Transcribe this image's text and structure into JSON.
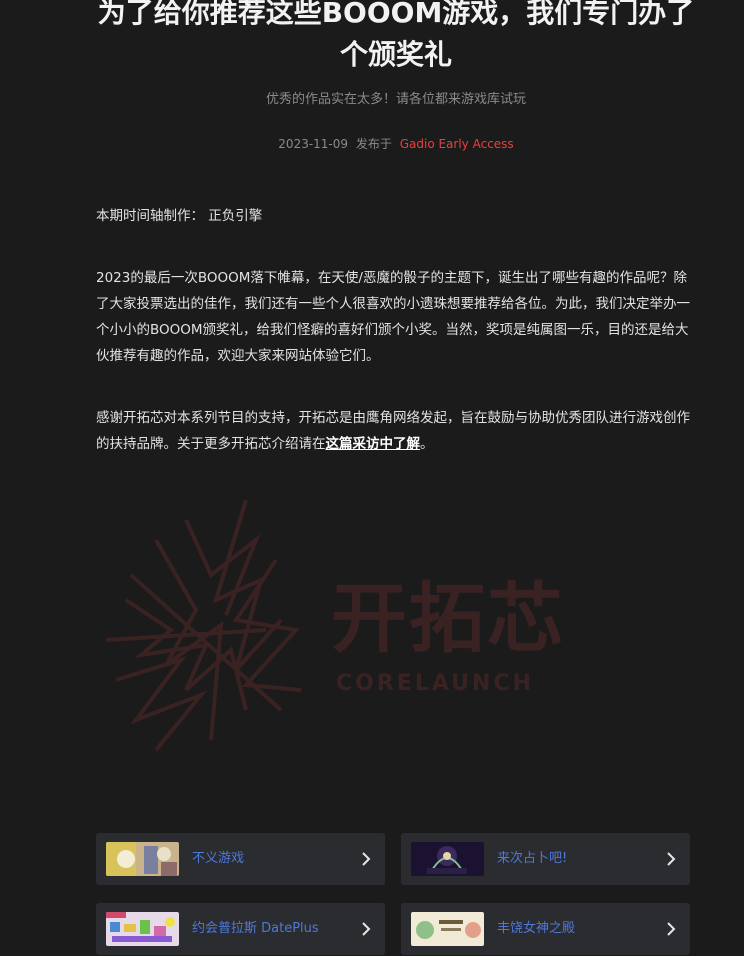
{
  "article": {
    "title": "为了给你推荐这些BOOOM游戏，我们专门办了个颁奖礼",
    "subtitle": "优秀的作品实在太多！请各位都来游戏库试玩",
    "date": "2023-11-09",
    "published_prefix": "发布于",
    "publisher": "Gadio Early Access",
    "credit": "本期时间轴制作： 正负引擎",
    "paragraph1": "2023的最后一次BOOOM落下帷幕，在天使/恶魔的骰子的主题下，诞生出了哪些有趣的作品呢？除了大家投票选出的佳作，我们还有一些个人很喜欢的小遗珠想要推荐给各位。为此，我们决定举办一个小小的BOOOM颁奖礼，给我们怪癖的喜好们颁个小奖。当然，奖项是纯属图一乐，目的还是给大伙推荐有趣的作品，欢迎大家来网站体验它们。",
    "paragraph2_before_link": "感谢开拓芯对本系列节目的支持，开拓芯是由鹰角网络发起，旨在鼓励与协助优秀团队进行游戏创作的扶持品牌。关于更多开拓芯介绍请在",
    "paragraph2_link": "这篇采访中了解",
    "paragraph2_after_link": "。"
  },
  "logo": {
    "text": "开拓芯",
    "sub_text": "CORELAUNCH",
    "color": "#3a2222"
  },
  "game_cards": [
    {
      "title": "不义游戏",
      "thumb_icon": "game-thumbnail-icon"
    },
    {
      "title": "来次占卜吧!",
      "thumb_icon": "game-thumbnail-icon"
    },
    {
      "title": "约会普拉斯 DatePlus",
      "thumb_icon": "game-thumbnail-icon"
    },
    {
      "title": "丰饶女神之殿",
      "thumb_icon": "game-thumbnail-icon"
    }
  ],
  "colors": {
    "background": "#1b1b1b",
    "card_background": "#2b2c30",
    "link_blue": "#4f78d8",
    "publisher_red": "#e8403d"
  }
}
